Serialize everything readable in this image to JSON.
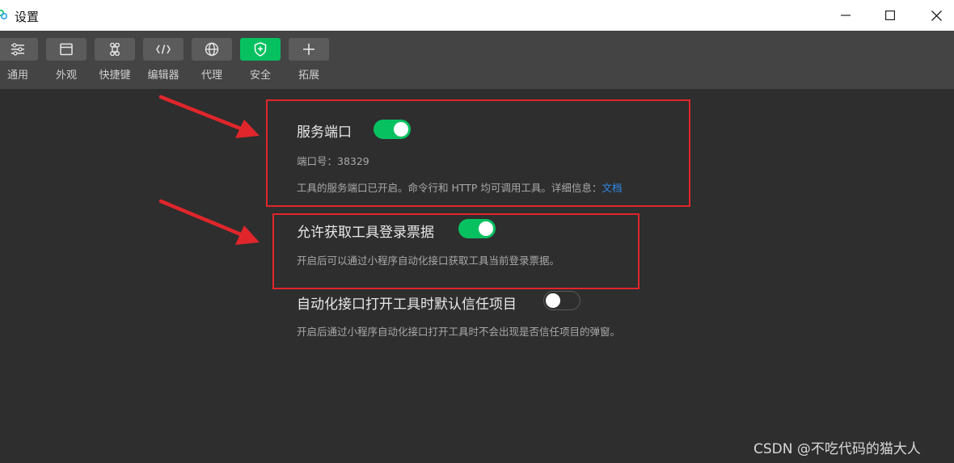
{
  "window": {
    "title": "设置"
  },
  "toolbar": {
    "tabs": [
      {
        "label": "通用",
        "icon": "sliders-icon"
      },
      {
        "label": "外观",
        "icon": "window-icon"
      },
      {
        "label": "快捷键",
        "icon": "command-icon"
      },
      {
        "label": "编辑器",
        "icon": "code-icon"
      },
      {
        "label": "代理",
        "icon": "globe-icon"
      },
      {
        "label": "安全",
        "icon": "shield-icon",
        "active": true
      },
      {
        "label": "拓展",
        "icon": "plus-icon"
      }
    ],
    "active_color": "#07c160"
  },
  "settings": {
    "service_port": {
      "title": "服务端口",
      "enabled": true,
      "port_line": "端口号：38329",
      "description": "工具的服务端口已开启。命令行和 HTTP 均可调用工具。详细信息：",
      "doc_link": "文档"
    },
    "login_ticket": {
      "title": "允许获取工具登录票据",
      "enabled": true,
      "description": "开启后可以通过小程序自动化接口获取工具当前登录票据。"
    },
    "trust_project": {
      "title": "自动化接口打开工具时默认信任项目",
      "enabled": false,
      "description": "开启后通过小程序自动化接口打开工具时不会出现是否信任项目的弹窗。"
    }
  },
  "annotation_color": "#e0262b",
  "watermark": "CSDN @不吃代码的猫大人"
}
